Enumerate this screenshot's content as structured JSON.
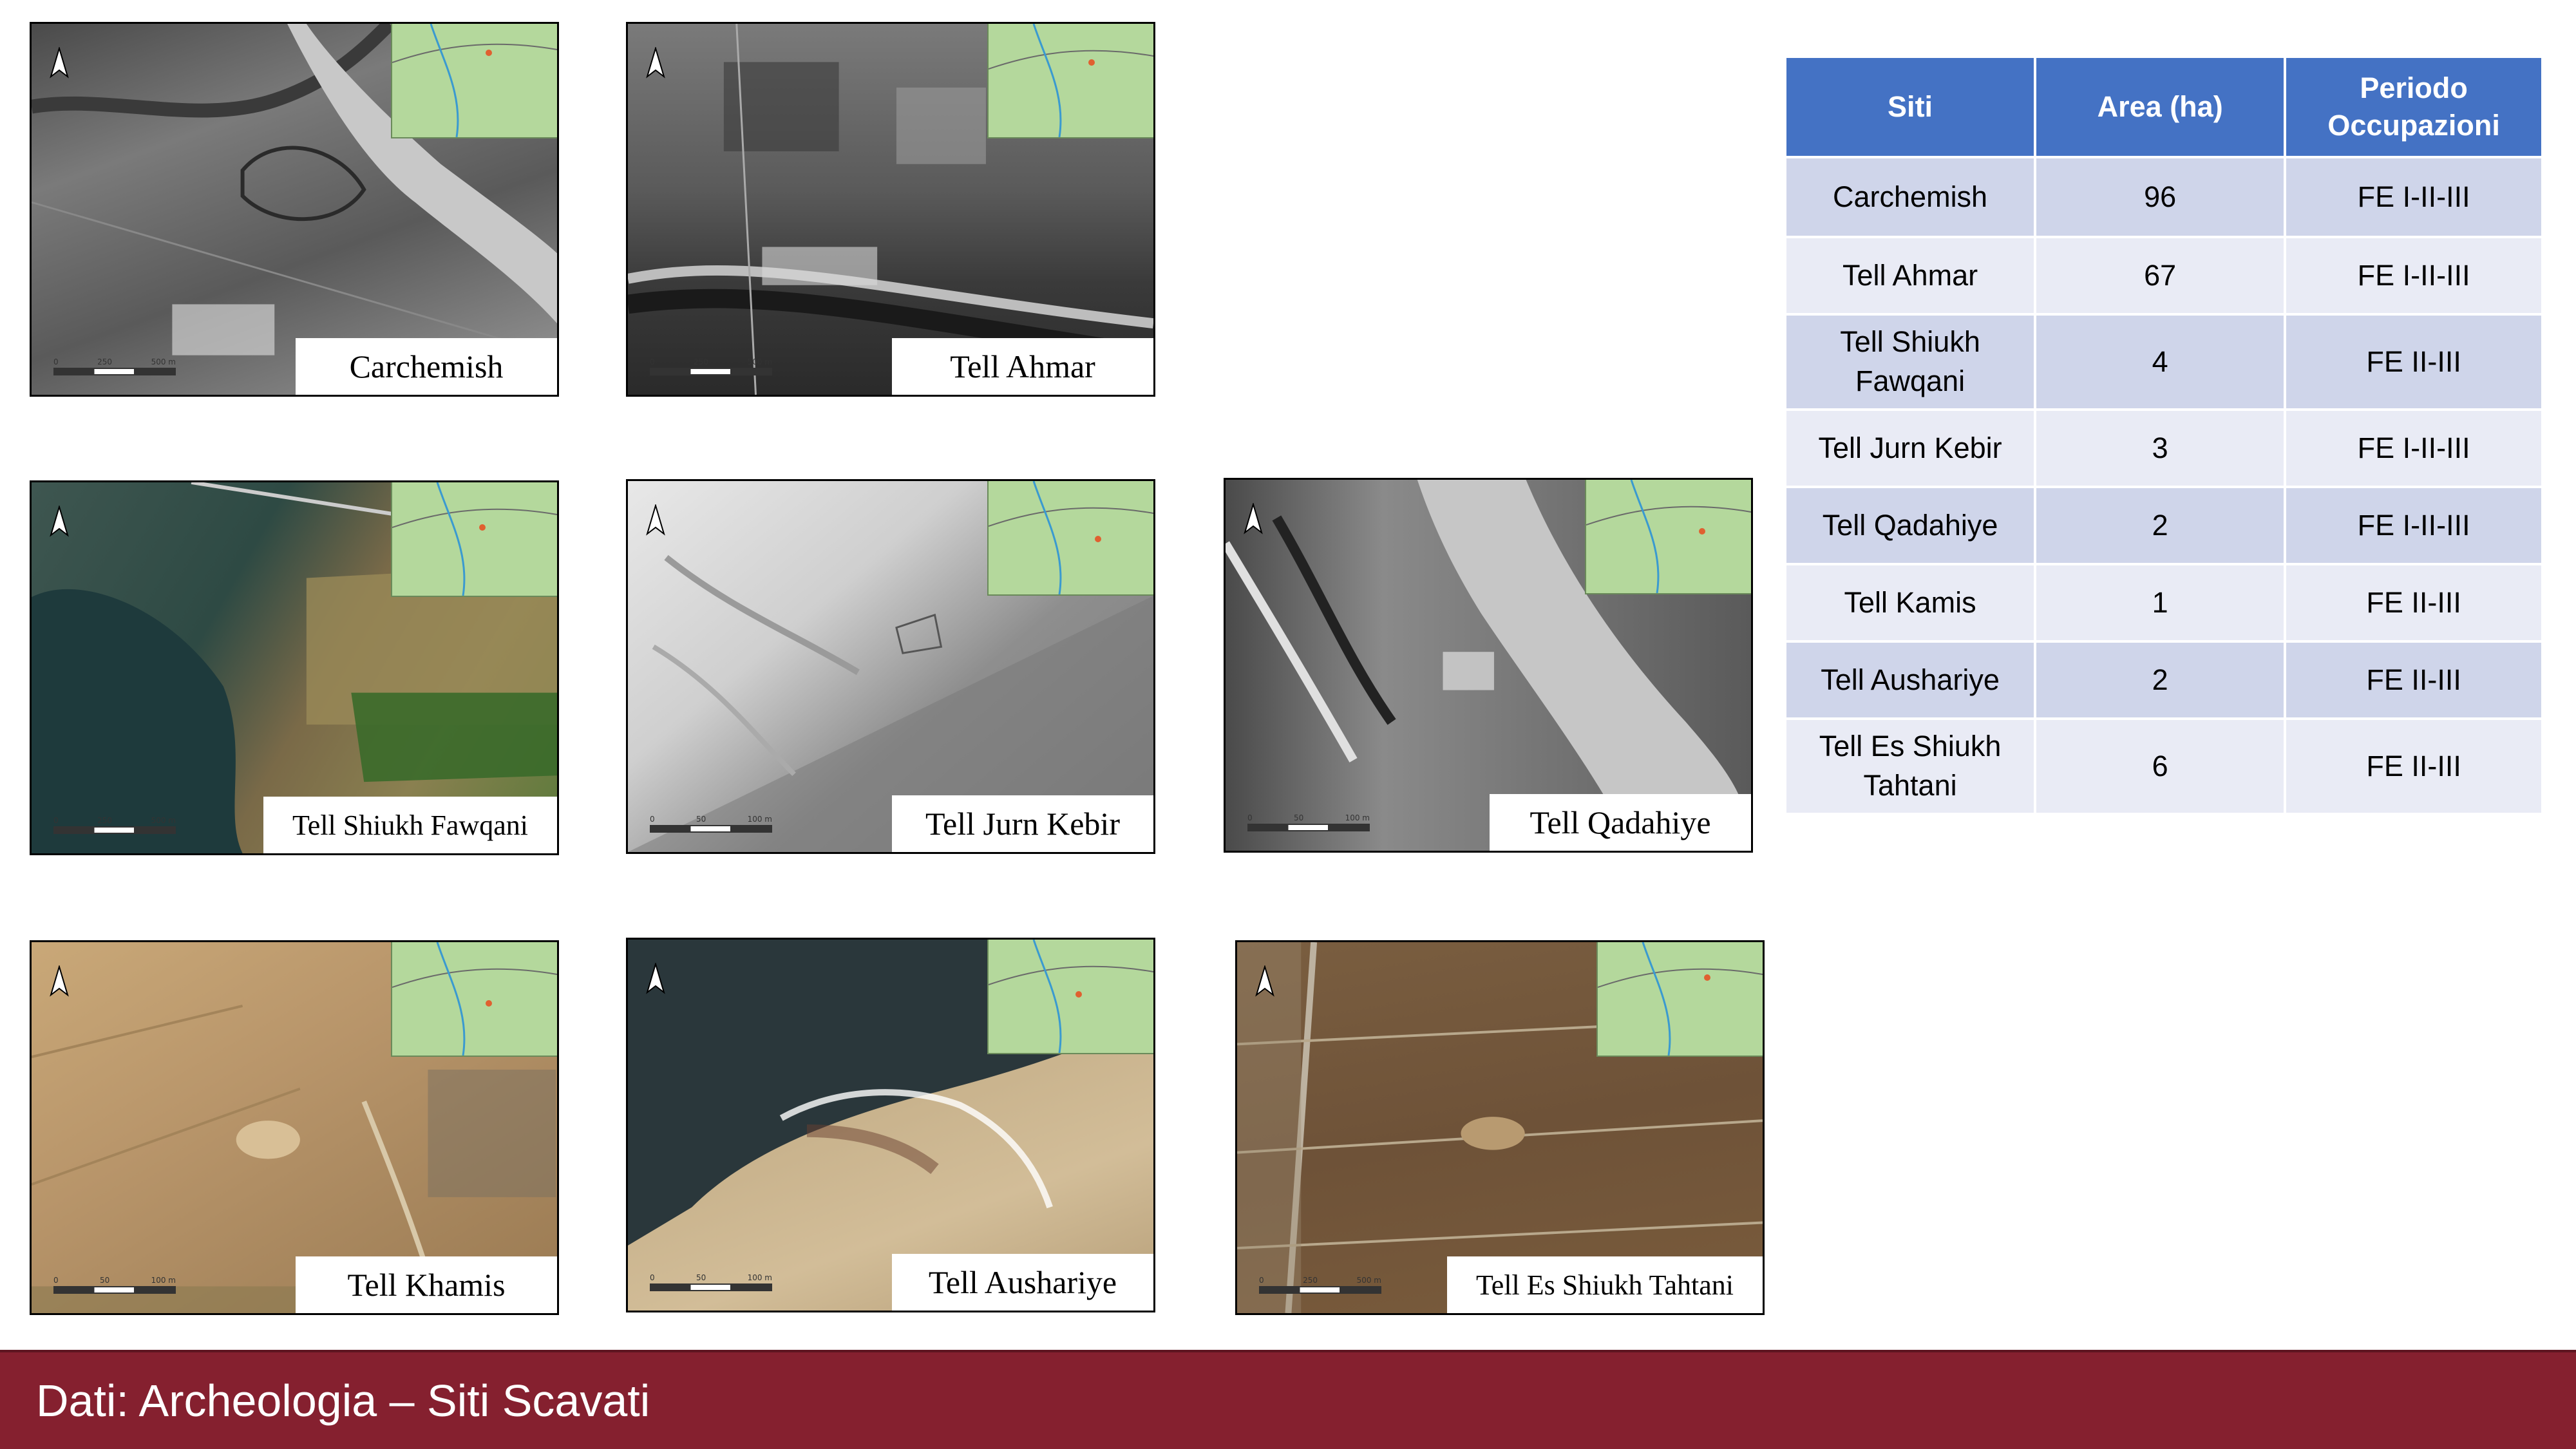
{
  "sites": [
    {
      "label": "Carchemish",
      "photo_style": "bw"
    },
    {
      "label": "Tell Ahmar",
      "photo_style": "bw"
    },
    {
      "label": "Tell Shiukh Fawqani",
      "photo_style": "color-green"
    },
    {
      "label": "Tell Jurn Kebir",
      "photo_style": "bw-light"
    },
    {
      "label": "Tell Qadahiye",
      "photo_style": "bw-river"
    },
    {
      "label": "Tell Khamis",
      "photo_style": "color-sand"
    },
    {
      "label": "Tell Aushariye",
      "photo_style": "color-lake"
    },
    {
      "label": "Tell Es Shiukh Tahtani",
      "photo_style": "color-fields"
    }
  ],
  "table": {
    "headers": [
      "Siti",
      "Area (ha)",
      "Periodo Occupazioni"
    ],
    "rows": [
      [
        "Carchemish",
        "96",
        "FE I-II-III"
      ],
      [
        "Tell Ahmar",
        "67",
        "FE I-II-III"
      ],
      [
        "Tell Shiukh Fawqani",
        "4",
        "FE II-III"
      ],
      [
        "Tell Jurn Kebir",
        "3",
        "FE I-II-III"
      ],
      [
        "Tell Qadahiye",
        "2",
        "FE I-II-III"
      ],
      [
        "Tell Kamis",
        "1",
        "FE II-III"
      ],
      [
        "Tell Aushariye",
        "2",
        "FE II-III"
      ],
      [
        "Tell Es Shiukh Tahtani",
        "6",
        "FE II-III"
      ]
    ]
  },
  "footer": {
    "title": "Dati: Archeologia – Siti Scavati"
  },
  "colors": {
    "table_header": "#4472c4",
    "row_dark": "#cfd5ea",
    "row_light": "#e9ebf5",
    "footer": "#85202f"
  }
}
